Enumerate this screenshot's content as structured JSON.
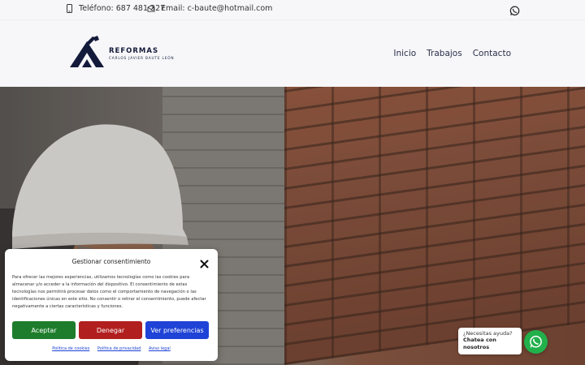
{
  "topbar": {
    "phone": "Teléfono: 687 481 327",
    "email": "Email: c-baute@hotmail.com"
  },
  "logo": {
    "title": "REFORMAS",
    "subtitle": "CARLOS JAVIER BAUTE LEÓN"
  },
  "nav": {
    "items": [
      "Inicio",
      "Trabajos",
      "Contacto"
    ]
  },
  "cookie": {
    "title": "Gestionar consentimiento",
    "text": "Para ofrecer las mejores experiencias, utilizamos tecnologías como las cookies para almacenar y/o acceder a la información del dispositivo. El consentimiento de estas tecnologías nos permitirá procesar datos como el comportamiento de navegación o las identificaciones únicas en este sitio. No consentir o retirar el consentimiento, puede afectar negativamente a ciertas características y funciones.",
    "accept": "Aceptar",
    "deny": "Denegar",
    "prefs": "Ver preferencias",
    "links": [
      "Política de cookies",
      "Política de privacidad",
      "Aviso legal"
    ]
  },
  "chat": {
    "question": "¿Necesitas ayuda?",
    "action": "Chatea con nosotros"
  },
  "colors": {
    "accept": "#1e7d2c",
    "deny": "#b21f1f",
    "prefs": "#1e43d6",
    "whatsapp": "#22b04b",
    "brand": "#131a3a"
  }
}
